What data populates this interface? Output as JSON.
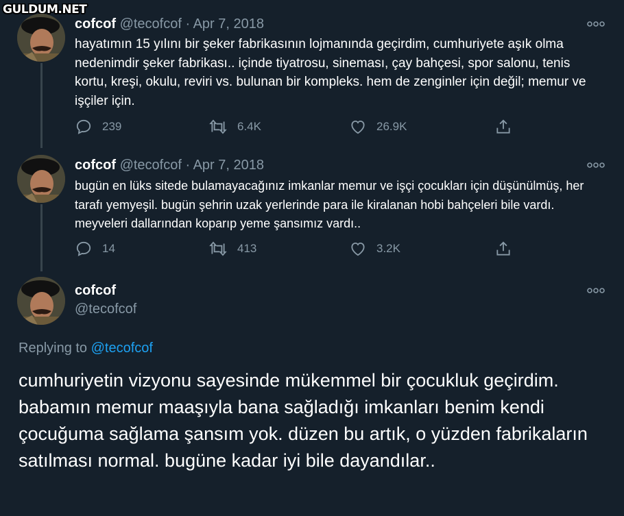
{
  "watermark": "GULDUM.NET",
  "tweets": [
    {
      "name": "cofcof",
      "handle": "@tecofcof",
      "separator": "·",
      "date": "Apr 7, 2018",
      "text": "hayatımın 15 yılını bir şeker fabrikasının lojmanında geçirdim, cumhuriyete aşık olma nedenimdir şeker fabrikası.. içinde tiyatrosu, sineması, çay bahçesi, spor salonu, tenis kortu, kreşi, okulu, reviri vs. bulunan bir kompleks. hem de zenginler için değil; memur ve işçiler için.",
      "replies": "239",
      "retweets": "6.4K",
      "likes": "26.9K"
    },
    {
      "name": "cofcof",
      "handle": "@tecofcof",
      "separator": "·",
      "date": "Apr 7, 2018",
      "text": "bugün en lüks sitede bulamayacağınız imkanlar memur ve işçi çocukları için düşünülmüş, her tarafı yemyeşil. bugün şehrin uzak yerlerinde para ile kiralanan hobi bahçeleri bile vardı. meyveleri dallarından koparıp yeme şansımız vardı..",
      "replies": "14",
      "retweets": "413",
      "likes": "3.2K"
    }
  ],
  "main_tweet": {
    "name": "cofcof",
    "handle": "@tecofcof",
    "replying_label": "Replying to",
    "replying_handle": "@tecofcof",
    "text": "cumhuriyetin vizyonu sayesinde mükemmel bir çocukluk geçirdim. babamın memur maaşıyla bana sağladığı imkanları benim kendi çocuğuma sağlama şansım yok.  düzen bu artık, o yüzden fabrikaların satılması normal. bugüne kadar iyi bile dayandılar.."
  },
  "colors": {
    "background": "#15202b",
    "text": "#ffffff",
    "muted": "#8899a6",
    "link": "#1da1f2",
    "thread_line": "#38444d"
  },
  "icons": [
    "reply-icon",
    "retweet-icon",
    "like-icon",
    "share-icon",
    "more-icon"
  ]
}
